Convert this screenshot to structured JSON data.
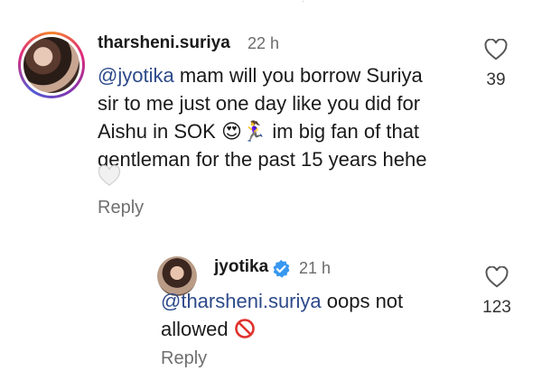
{
  "comment": {
    "username": "tharsheni.suriya",
    "time": "22 h",
    "mention": "@jyotika",
    "line1_rest": " mam will you borrow Suriya",
    "line2": "sir to me just one day like you did for",
    "line3_a": "Aishu in SOK ",
    "line3_emoji": "😍🏃‍♀️",
    "line3_b": " im big fan of that",
    "line4": "gentleman for the past 15 years hehe",
    "likes": "39",
    "reply_label": "Reply"
  },
  "reply": {
    "username": "jyotika",
    "time": "21 h",
    "mention": "@tharsheni.suriya",
    "text_rest": " oops not",
    "line2": "allowed ",
    "likes": "123",
    "reply_label": "Reply"
  },
  "colors": {
    "mention": "#2d4a8a",
    "verified": "#3897f0",
    "muted": "#6f6f6f"
  }
}
